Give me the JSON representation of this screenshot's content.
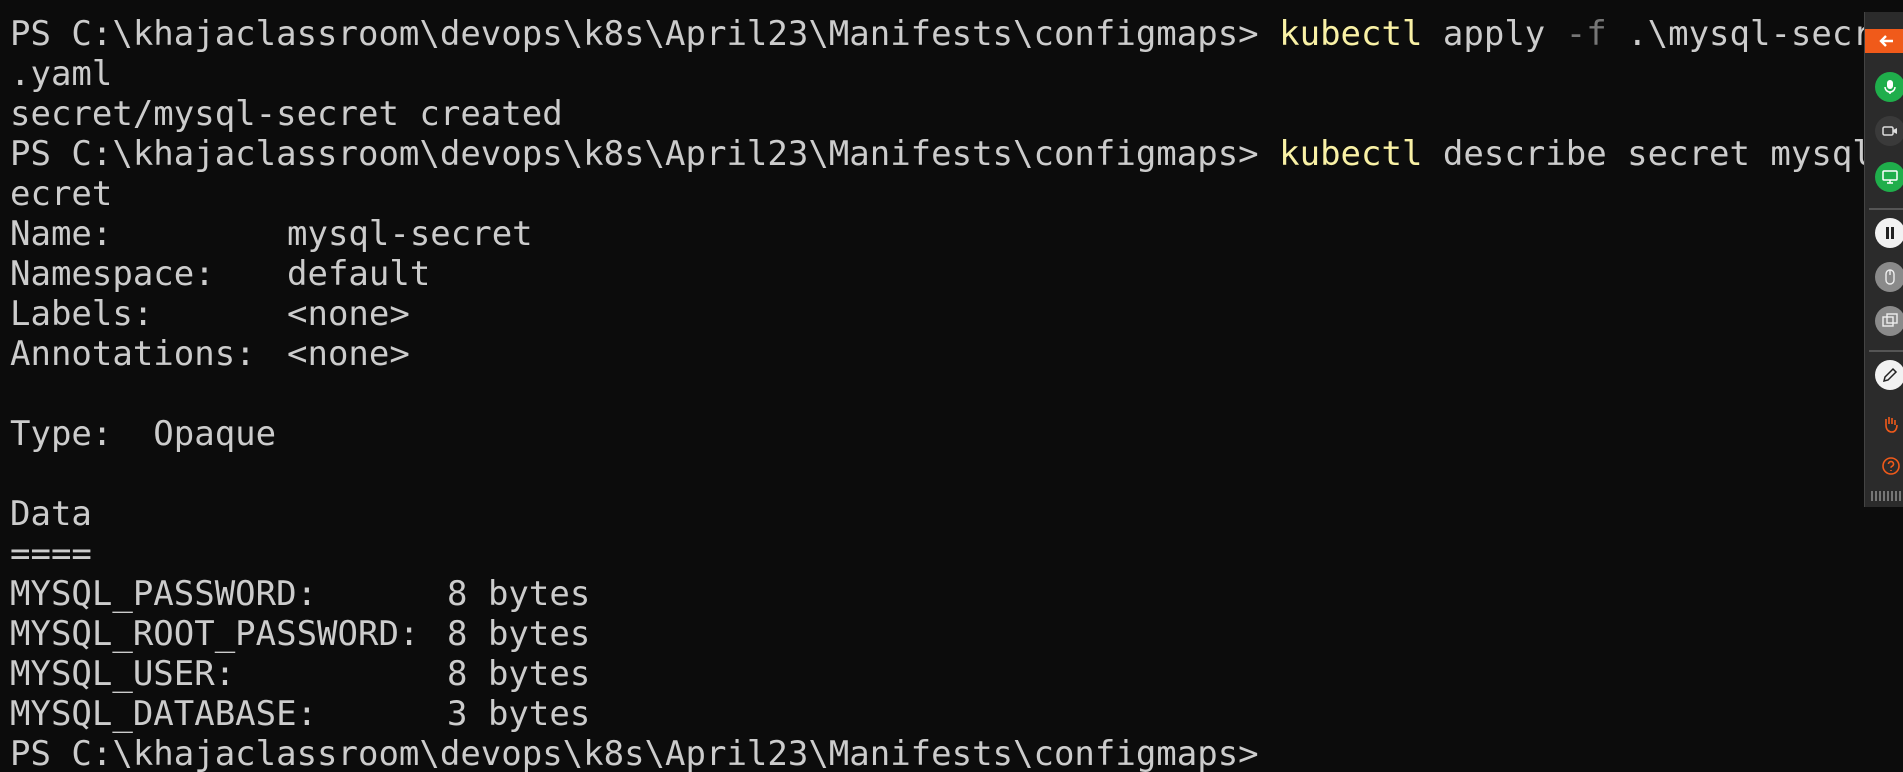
{
  "terminal": {
    "prompt": "PS C:\\khajaclassroom\\devops\\k8s\\April23\\Manifests\\configmaps>",
    "cmd1": {
      "tool": "kubectl",
      "args_a": " apply ",
      "flag": "-f",
      "args_b": " .\\mysql-secret",
      "wrap": ".yaml"
    },
    "output1": "secret/mysql-secret created",
    "cmd2": {
      "tool": "kubectl",
      "args": " describe secret mysql-s",
      "wrap": "ecret"
    },
    "describe": {
      "name_label": "Name:",
      "name_value": "mysql-secret",
      "namespace_label": "Namespace:",
      "namespace_value": "default",
      "labels_label": "Labels:",
      "labels_value": "<none>",
      "annotations_label": "Annotations:",
      "annotations_value": "<none>",
      "type_line": "Type:  Opaque",
      "data_header": "Data",
      "data_rule": "===="
    },
    "data_rows": [
      {
        "key": "MYSQL_PASSWORD:",
        "value": "8 bytes"
      },
      {
        "key": "MYSQL_ROOT_PASSWORD:",
        "value": "8 bytes"
      },
      {
        "key": "MYSQL_USER:",
        "value": "8 bytes"
      },
      {
        "key": "MYSQL_DATABASE:",
        "value": "3 bytes"
      }
    ]
  },
  "toolbar": {
    "icons": [
      "collapse-arrow-icon",
      "microphone-icon",
      "camera-icon",
      "screen-share-icon",
      "pause-icon",
      "mouse-icon",
      "window-icon",
      "pen-icon",
      "hand-icon",
      "help-icon"
    ]
  },
  "colors": {
    "background": "#0c0c0c",
    "text": "#cccccc",
    "command": "#f9f1a5",
    "flag": "#767676",
    "toolbar_accent": "#f05a1a",
    "toolbar_green": "#1fae4b"
  }
}
